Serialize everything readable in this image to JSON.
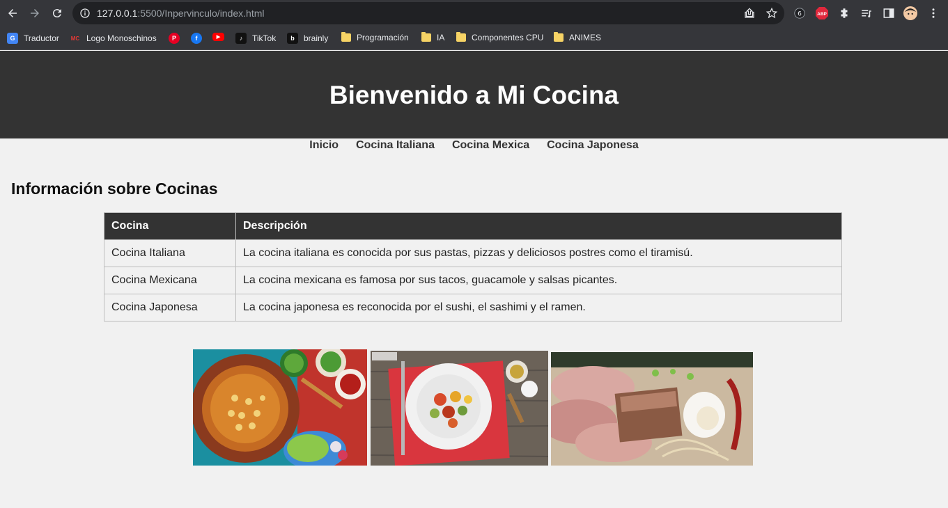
{
  "browser": {
    "url_host": "127.0.0.1",
    "url_rest": ":5500/Inpervinculo/index.html",
    "bookmarks": [
      {
        "label": "Traductor",
        "icon": "google-translate-icon"
      },
      {
        "label": "Logo Monoschinos",
        "icon": "monoschinos-icon"
      },
      {
        "label": "",
        "icon": "pinterest-icon"
      },
      {
        "label": "",
        "icon": "facebook-icon"
      },
      {
        "label": "",
        "icon": "youtube-icon"
      },
      {
        "label": "TikTok",
        "icon": "tiktok-icon"
      },
      {
        "label": "brainly",
        "icon": "brainly-icon"
      },
      {
        "label": "Programación",
        "icon": "folder-icon"
      },
      {
        "label": "IA",
        "icon": "folder-icon"
      },
      {
        "label": "Componentes CPU",
        "icon": "folder-icon"
      },
      {
        "label": "ANIMES",
        "icon": "folder-icon"
      }
    ],
    "ext_abp_label": "ABP"
  },
  "site": {
    "title": "Bienvenido a Mi Cocina",
    "nav": [
      "Inicio",
      "Cocina Italiana",
      "Cocina Mexica",
      "Cocina Japonesa"
    ],
    "section_title": "Información sobre Cocinas",
    "table": {
      "headers": [
        "Cocina",
        "Descripción"
      ],
      "rows": [
        [
          "Cocina Italiana",
          "La cocina italiana es conocida por sus pastas, pizzas y deliciosos postres como el tiramisú."
        ],
        [
          "Cocina Mexicana",
          "La cocina mexicana es famosa por sus tacos, guacamole y salsas picantes."
        ],
        [
          "Cocina Japonesa",
          "La cocina japonesa es reconocida por el sushi, el sashimi y el ramen."
        ]
      ]
    }
  },
  "colors": {
    "header_bg": "#333333",
    "page_bg": "#f1f1f1",
    "chrome_bg": "#35363a"
  }
}
